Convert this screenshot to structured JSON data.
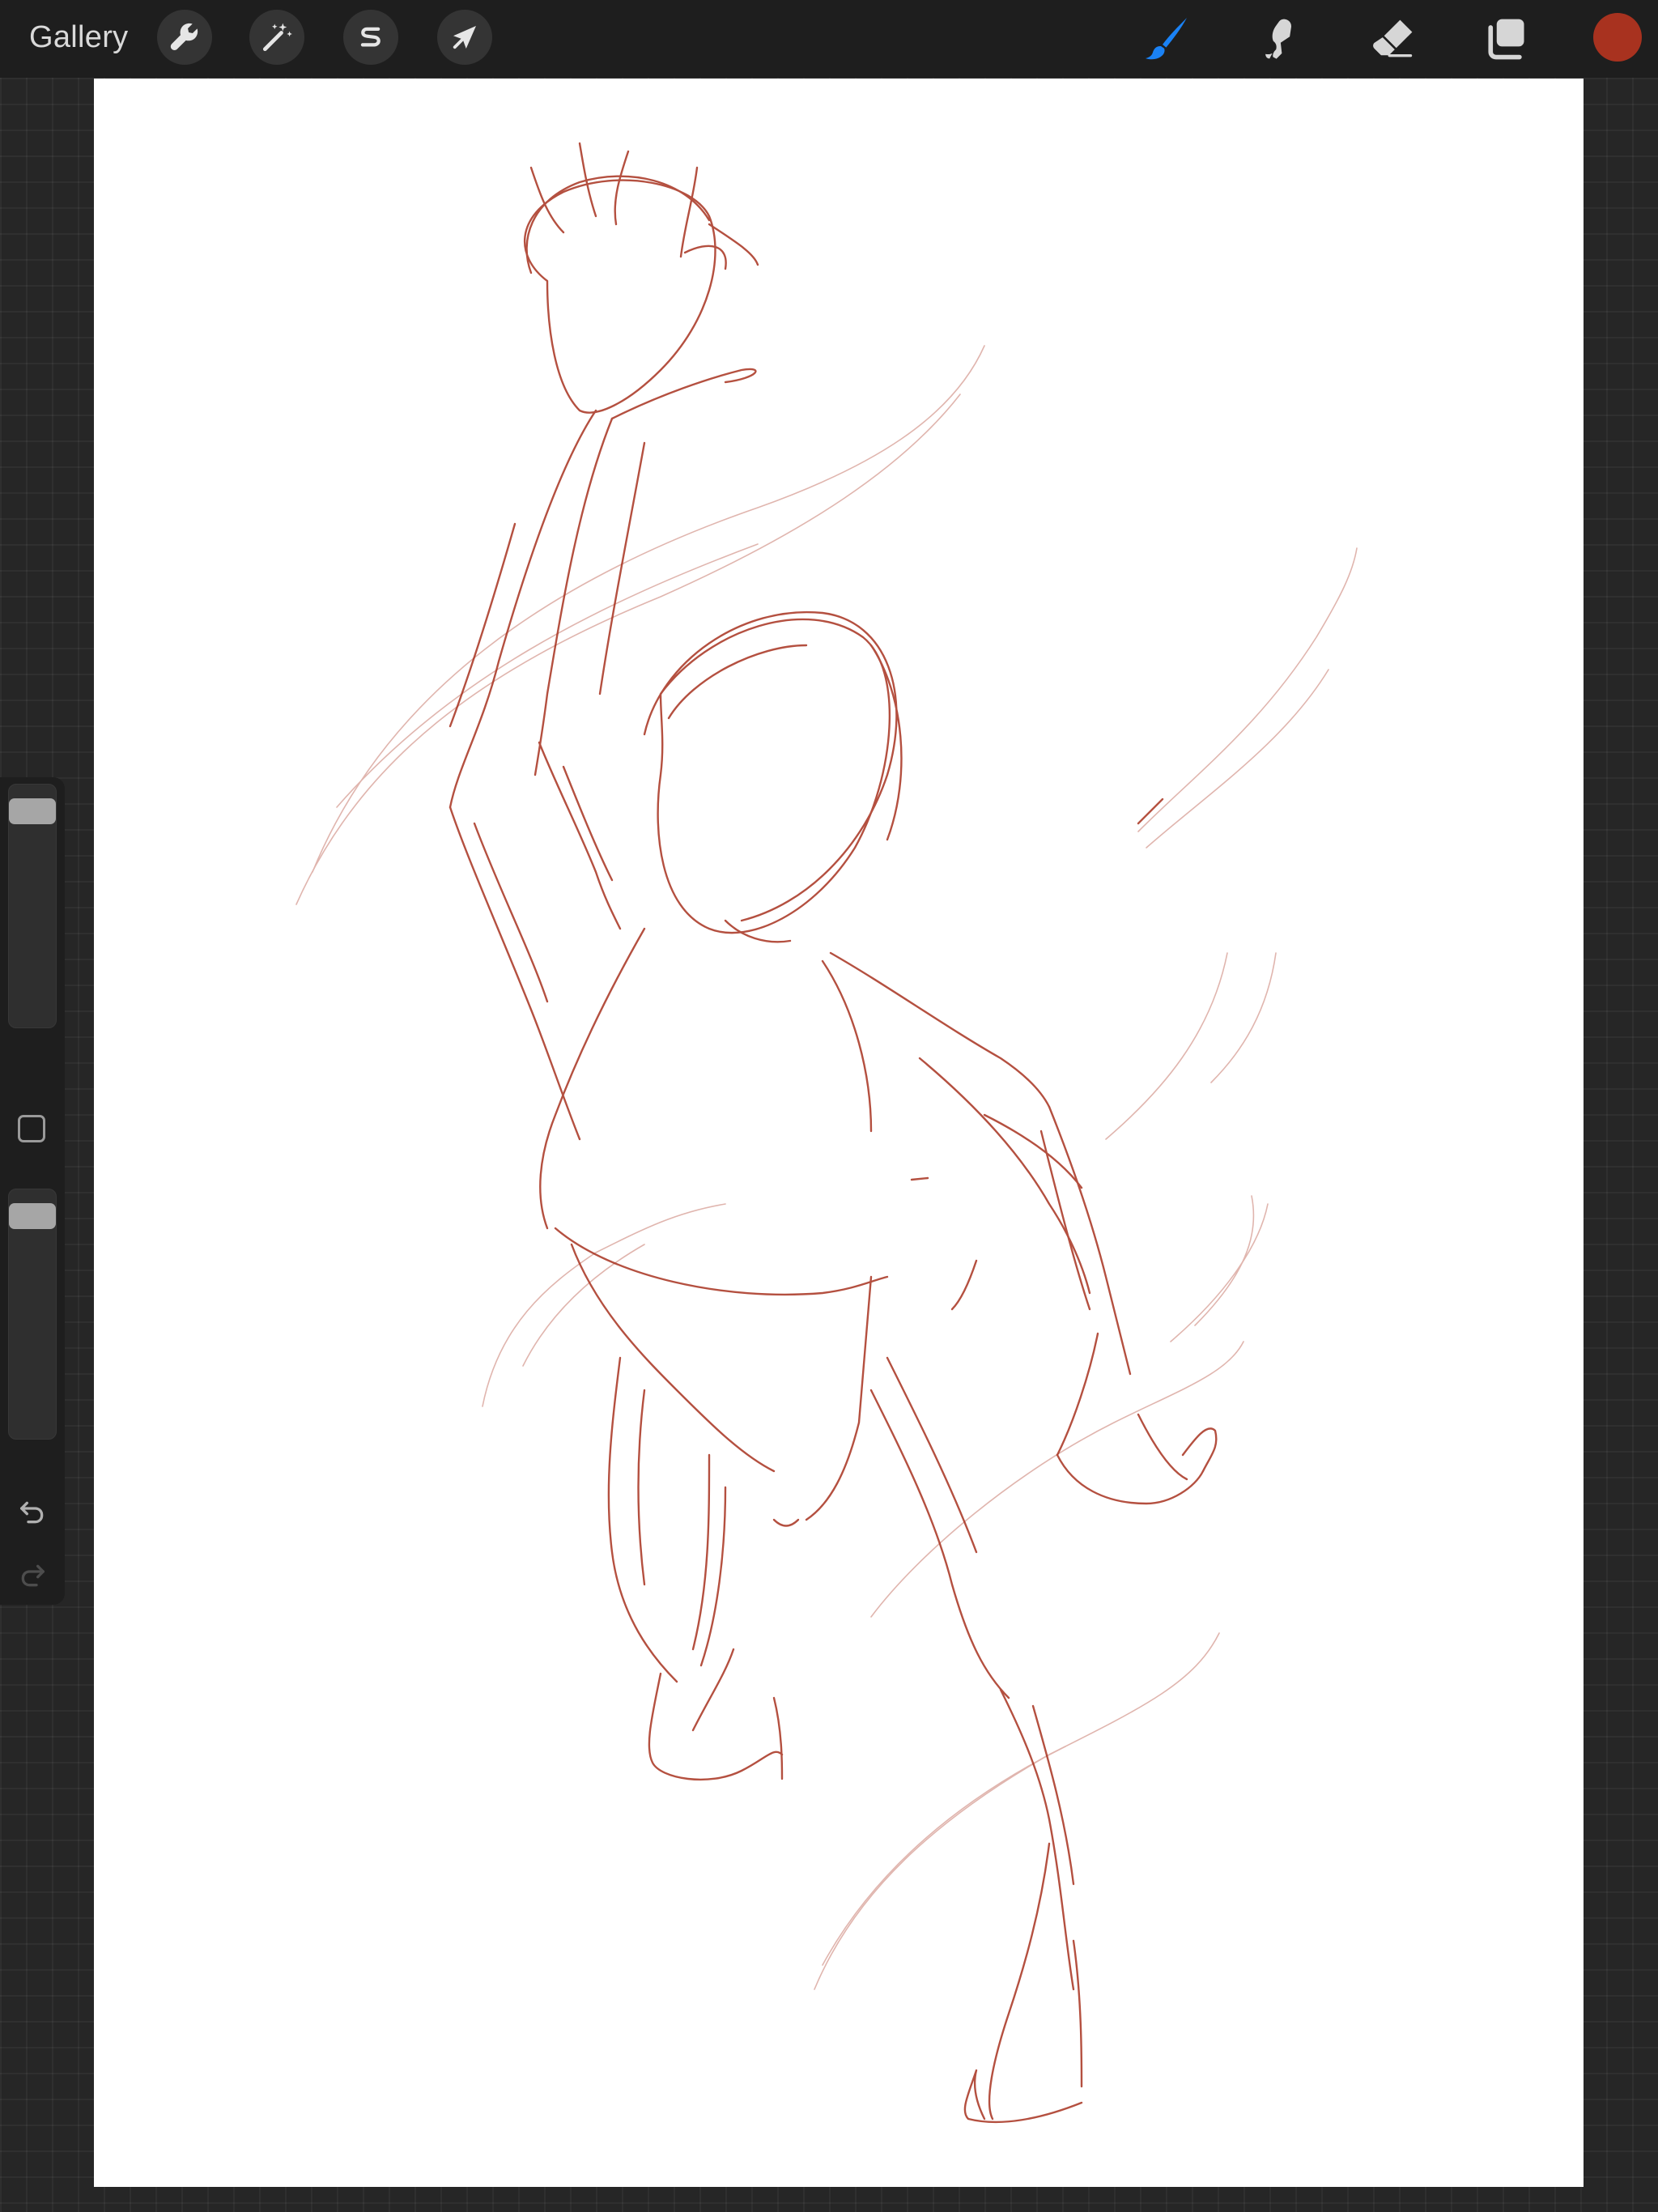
{
  "topbar": {
    "gallery_label": "Gallery",
    "left_tools": [
      {
        "name": "wrench-icon",
        "meaning": "actions"
      },
      {
        "name": "magic-wand-icon",
        "meaning": "adjustments"
      },
      {
        "name": "selection-s-icon",
        "meaning": "selection"
      },
      {
        "name": "cursor-arrow-icon",
        "meaning": "transform"
      }
    ],
    "right_tools": [
      {
        "name": "brush-icon",
        "meaning": "paint",
        "active": true
      },
      {
        "name": "smudge-icon",
        "meaning": "smudge",
        "active": false
      },
      {
        "name": "eraser-icon",
        "meaning": "erase",
        "active": false
      },
      {
        "name": "layers-icon",
        "meaning": "layers",
        "active": false
      }
    ],
    "current_color": "#a8321f"
  },
  "sidebar": {
    "brush_size_level": 0.95,
    "brush_opacity_level": 0.95,
    "undo_icon": "undo-arrow-icon",
    "redo_icon": "redo-arrow-icon",
    "redo_enabled": false
  },
  "colors": {
    "accent_blue": "#1a82f5",
    "sketch_stroke": "#a8321f",
    "canvas": "#ffffff",
    "ui_background": "#1e1e1e"
  }
}
